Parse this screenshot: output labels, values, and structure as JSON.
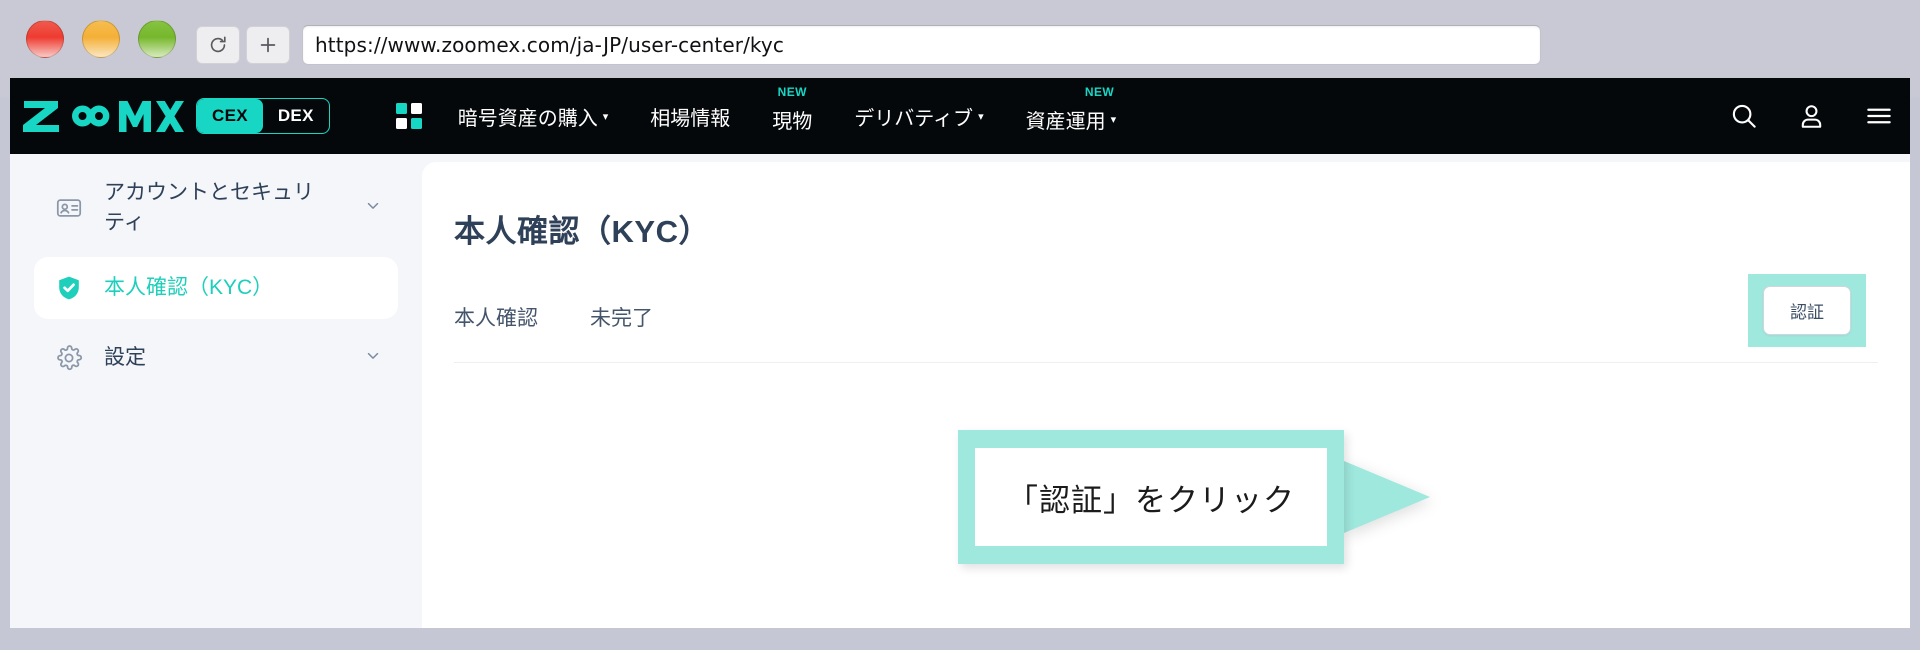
{
  "browser": {
    "url": "https://www.zoomex.com/ja-JP/user-center/kyc",
    "reload_icon": "reload-icon",
    "newtab_icon": "plus-icon",
    "traffic_lights": [
      "close",
      "minimize",
      "maximize"
    ]
  },
  "header": {
    "brand": "ZOOMEX",
    "toggle": {
      "active": "CEX",
      "inactive": "DEX"
    },
    "grid_icon": "grid-apps-icon",
    "nav": [
      {
        "label": "暗号資産の購入",
        "caret": "▾",
        "badge": ""
      },
      {
        "label": "相場情報",
        "caret": "",
        "badge": ""
      },
      {
        "label": "現物",
        "caret": "",
        "badge": "NEW"
      },
      {
        "label": "デリバティブ",
        "caret": "▾",
        "badge": ""
      },
      {
        "label": "資産運用",
        "caret": "▾",
        "badge": "NEW"
      }
    ],
    "icons": [
      "search-icon",
      "user-icon",
      "hamburger-menu-icon"
    ]
  },
  "sidebar": {
    "items": [
      {
        "label": "アカウントとセキュリティ",
        "icon": "id-card-icon",
        "chevron": "chevron-down",
        "active": false
      },
      {
        "label": "本人確認（KYC）",
        "icon": "shield-check-icon",
        "chevron": "",
        "active": true
      },
      {
        "label": "設定",
        "icon": "gear-icon",
        "chevron": "chevron-down",
        "active": false
      }
    ]
  },
  "main": {
    "title": "本人確認（KYC）",
    "row": {
      "label": "本人確認",
      "status": "未完了",
      "action_button": "認証"
    }
  },
  "callout": {
    "text": "「認証」をクリック"
  },
  "colors": {
    "brand_teal": "#18d6c4",
    "mint_highlight": "#9fe8de",
    "header_bg": "#05080b",
    "page_bg": "#f4f6fa",
    "text_navy": "#2f4158"
  }
}
